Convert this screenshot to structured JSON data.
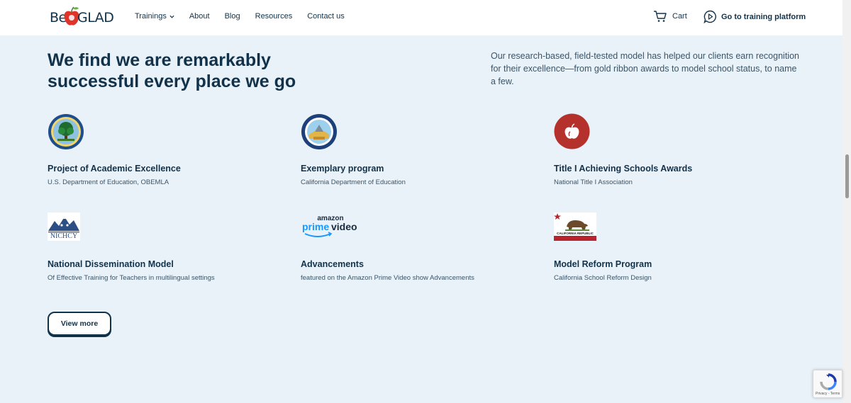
{
  "header": {
    "logo_left": "Be",
    "logo_right": "GLAD",
    "nav": [
      {
        "label": "Trainings",
        "has_dropdown": true
      },
      {
        "label": "About"
      },
      {
        "label": "Blog"
      },
      {
        "label": "Resources"
      },
      {
        "label": "Contact us"
      }
    ],
    "cart_label": "Cart",
    "platform_label": "Go to training platform"
  },
  "main": {
    "headline": "We find we are remarkably successful every place we go",
    "intro": "Our research-based, field-tested model has helped our clients earn recognition for their excellence—from gold ribbon awards to model school status, to name a few.",
    "awards": [
      {
        "title": "Project of Academic Excellence",
        "subtitle": "U.S. Department of Education, OBEMLA",
        "icon": "us-dept-education-seal-icon"
      },
      {
        "title": "Exemplary program",
        "subtitle": "California Department of Education",
        "icon": "ca-dept-education-seal-icon"
      },
      {
        "title": "Title I Achieving Schools Awards",
        "subtitle": "National Title I Association",
        "icon": "apple-logo-icon"
      },
      {
        "title": "National Dissemination Model",
        "subtitle": "Of Effective Training for Teachers in multilingual settings",
        "icon": "nichcy-logo-icon",
        "logo_text": "NICHCY"
      },
      {
        "title": "Advancements",
        "subtitle": "featured on the Amazon Prime Video show Advancements",
        "icon": "amazon-prime-video-logo-icon",
        "logo_top": "amazon",
        "logo_bottom_a": "prime",
        "logo_bottom_b": "video"
      },
      {
        "title": "Model Reform Program",
        "subtitle": "California School Reform Design",
        "icon": "california-flag-icon",
        "logo_text": "CALIFORNIA REPUBLIC"
      }
    ],
    "view_more_label": "View more"
  },
  "recaptcha": {
    "text": "Privacy - Terms"
  },
  "colors": {
    "background": "#e9f1f9",
    "navy": "#12324a",
    "apple_red": "#b5312b",
    "amazon_blue": "#1a98ff"
  }
}
